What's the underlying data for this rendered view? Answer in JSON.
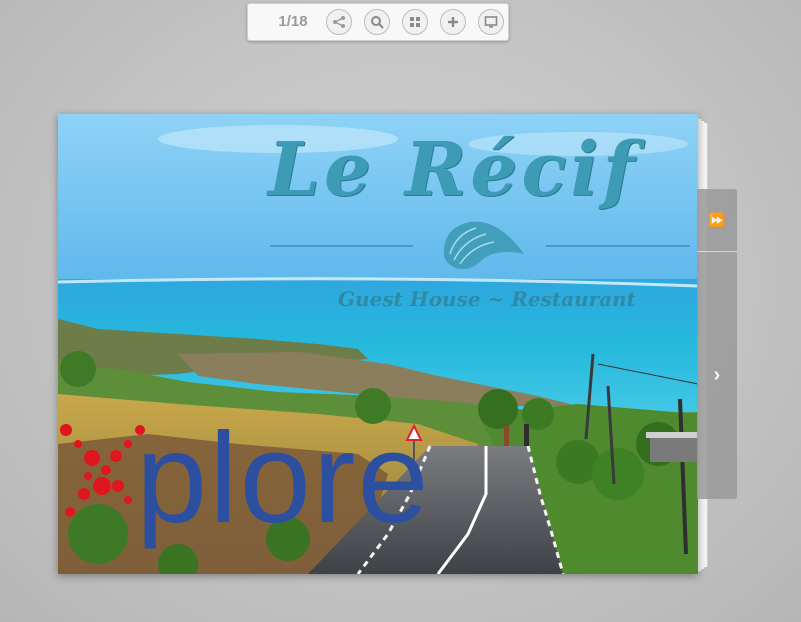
{
  "toolbar": {
    "page_counter": "1/18",
    "buttons": [
      {
        "name": "share-icon"
      },
      {
        "name": "search-icon"
      },
      {
        "name": "thumbnails-icon"
      },
      {
        "name": "zoom-in-icon"
      },
      {
        "name": "fullscreen-icon"
      }
    ]
  },
  "cover": {
    "title": "Le Récif",
    "subtitle": "Guest House ~ Restaurant",
    "brand_word": "plore",
    "colors": {
      "title": "#3d9bb6",
      "brand_word": "#2d4fa0",
      "brand_dots": "#e0161e"
    }
  },
  "side_nav": {
    "last_glyph": "⏩",
    "next_glyph": "›"
  }
}
